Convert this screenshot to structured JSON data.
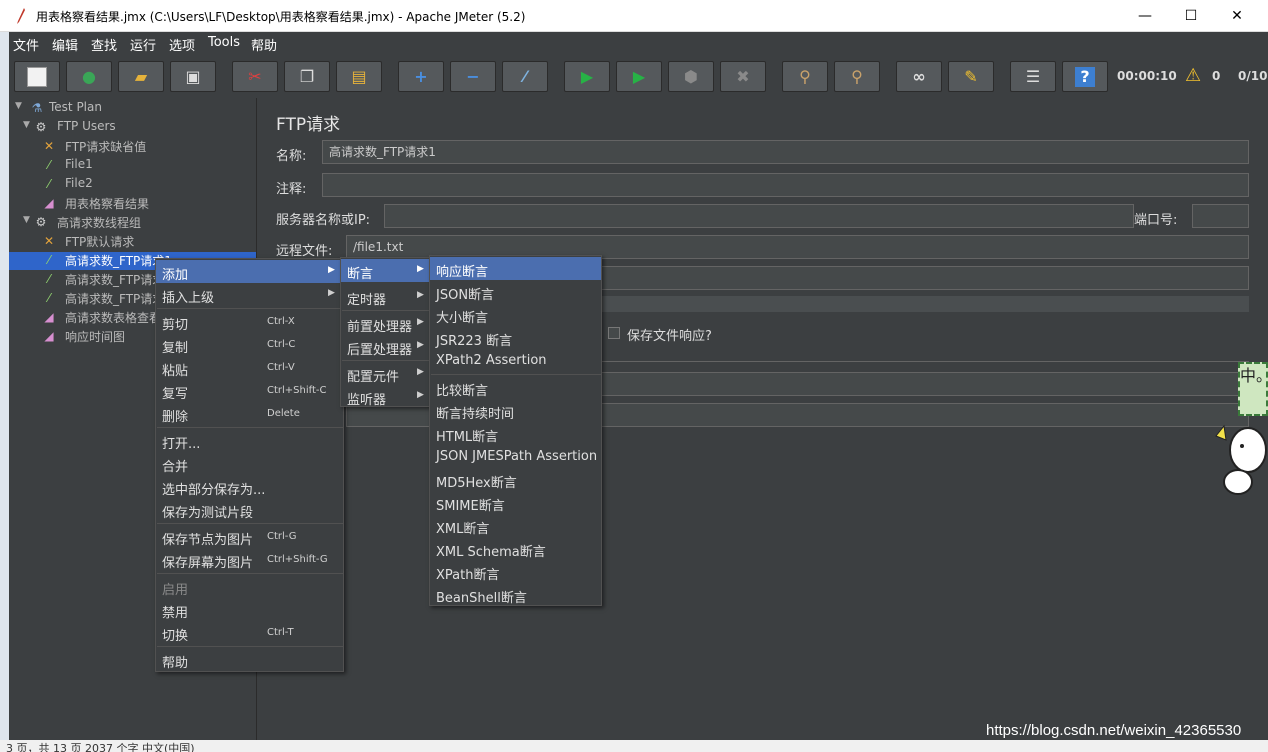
{
  "window": {
    "title": "用表格察看结果.jmx (C:\\Users\\LF\\Desktop\\用表格察看结果.jmx) - Apache JMeter (5.2)",
    "minimize": "—",
    "maximize": "☐",
    "close": "✕"
  },
  "menubar": [
    "文件",
    "编辑",
    "查找",
    "运行",
    "选项",
    "Tools",
    "帮助"
  ],
  "toolbar": {
    "elapsed": "00:00:10",
    "warnings": "0",
    "threads": "0/10"
  },
  "tree": [
    {
      "label": "Test Plan",
      "icon": "flask-icon"
    },
    {
      "label": "FTP Users",
      "icon": "gear-icon"
    },
    {
      "label": "FTP请求缺省值",
      "icon": "config-icon"
    },
    {
      "label": "File1",
      "icon": "sampler-icon"
    },
    {
      "label": "File2",
      "icon": "sampler-icon"
    },
    {
      "label": "用表格察看结果",
      "icon": "listener-icon"
    },
    {
      "label": "高请求数线程组",
      "icon": "gear-icon"
    },
    {
      "label": "FTP默认请求",
      "icon": "config-icon"
    },
    {
      "label": "高请求数_FTP请求1",
      "icon": "sampler-icon"
    },
    {
      "label": "高请求数_FTP请求2",
      "icon": "sampler-icon"
    },
    {
      "label": "高请求数_FTP请求3",
      "icon": "sampler-icon"
    },
    {
      "label": "高请求数表格查看结果",
      "icon": "listener-icon"
    },
    {
      "label": "响应时间图",
      "icon": "listener-icon"
    }
  ],
  "editor": {
    "title": "FTP请求",
    "name_label": "名称:",
    "name_value": "高请求数_FTP请求1",
    "comment_label": "注释:",
    "server_label": "服务器名称或IP:",
    "port_label": "端口号:",
    "remote_file_label": "远程文件:",
    "remote_file_value": "/file1.txt",
    "save_response_label": "保存文件响应?"
  },
  "context_menu": [
    {
      "label": "添加",
      "arrow": true,
      "highlight": true
    },
    {
      "label": "插入上级",
      "arrow": true
    },
    {
      "sep": true
    },
    {
      "label": "剪切",
      "shortcut": "Ctrl-X"
    },
    {
      "label": "复制",
      "shortcut": "Ctrl-C"
    },
    {
      "label": "粘贴",
      "shortcut": "Ctrl-V"
    },
    {
      "label": "复写",
      "shortcut": "Ctrl+Shift-C"
    },
    {
      "label": "删除",
      "shortcut": "Delete"
    },
    {
      "sep": true
    },
    {
      "label": "打开..."
    },
    {
      "label": "合并"
    },
    {
      "label": "选中部分保存为..."
    },
    {
      "label": "保存为测试片段"
    },
    {
      "sep": true
    },
    {
      "label": "保存节点为图片",
      "shortcut": "Ctrl-G"
    },
    {
      "label": "保存屏幕为图片",
      "shortcut": "Ctrl+Shift-G"
    },
    {
      "sep": true
    },
    {
      "label": "启用",
      "disabled": true
    },
    {
      "label": "禁用"
    },
    {
      "label": "切换",
      "shortcut": "Ctrl-T"
    },
    {
      "sep": true
    },
    {
      "label": "帮助"
    }
  ],
  "add_submenu": [
    {
      "label": "断言",
      "highlight": true
    },
    {
      "label": "定时器"
    },
    {
      "label": "前置处理器"
    },
    {
      "label": "后置处理器"
    },
    {
      "label": "配置元件"
    },
    {
      "label": "监听器"
    }
  ],
  "assertion_submenu": [
    "响应断言",
    "JSON断言",
    "大小断言",
    "JSR223 断言",
    "XPath2 Assertion",
    "比较断言",
    "断言持续时间",
    "HTML断言",
    "JSON JMESPath Assertion",
    "MD5Hex断言",
    "SMIME断言",
    "XML断言",
    "XML Schema断言",
    "XPath断言",
    "BeanShell断言"
  ],
  "watermark": "https://blog.csdn.net/weixin_42365530",
  "statusbar": "3 页，共 13 页    2037 个字    中文(中国)",
  "sticker_text": "中。,",
  "colors": {
    "background": "#3c3f41",
    "selection": "#2f65ca",
    "menu_highlight": "#4b6eaf"
  }
}
